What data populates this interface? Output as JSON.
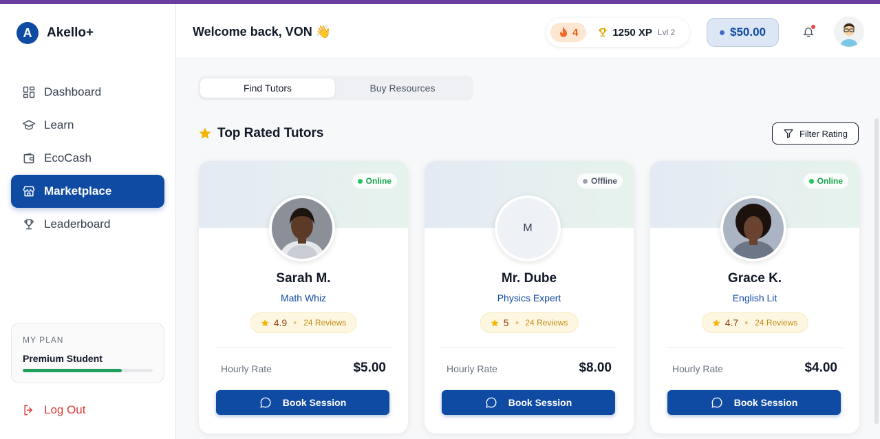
{
  "app": {
    "name": "Akello+",
    "logo_letter": "A",
    "accent": "#0f4aa3"
  },
  "sidebar": {
    "items": [
      {
        "label": "Dashboard",
        "icon": "grid-icon"
      },
      {
        "label": "Learn",
        "icon": "graduation-cap-icon"
      },
      {
        "label": "EcoCash",
        "icon": "wallet-icon"
      },
      {
        "label": "Marketplace",
        "icon": "store-icon",
        "active": true
      },
      {
        "label": "Leaderboard",
        "icon": "trophy-icon"
      }
    ],
    "plan": {
      "label": "MY PLAN",
      "name": "Premium Student",
      "progress": 0.76
    },
    "logout": "Log Out"
  },
  "header": {
    "welcome": "Welcome back, VON 👋",
    "streak": "4",
    "xp": "1250 XP",
    "level": "Lvl 2",
    "balance": "$50.00"
  },
  "tabs": [
    "Find Tutors",
    "Buy Resources"
  ],
  "section": {
    "title": "Top Rated Tutors",
    "filter": "Filter Rating"
  },
  "tutors": [
    {
      "name": "Sarah M.",
      "subject": "Math Whiz",
      "status": "Online",
      "rating": "4.9",
      "reviews": "24 Reviews",
      "rate_label": "Hourly Rate",
      "rate": "$5.00",
      "button": "Book Session"
    },
    {
      "name": "Mr. Dube",
      "subject": "Physics Expert",
      "status": "Offline",
      "initial": "M",
      "rating": "5",
      "reviews": "24 Reviews",
      "rate_label": "Hourly Rate",
      "rate": "$8.00",
      "button": "Book Session"
    },
    {
      "name": "Grace K.",
      "subject": "English Lit",
      "status": "Online",
      "rating": "4.7",
      "reviews": "24 Reviews",
      "rate_label": "Hourly Rate",
      "rate": "$4.00",
      "button": "Book Session"
    }
  ]
}
